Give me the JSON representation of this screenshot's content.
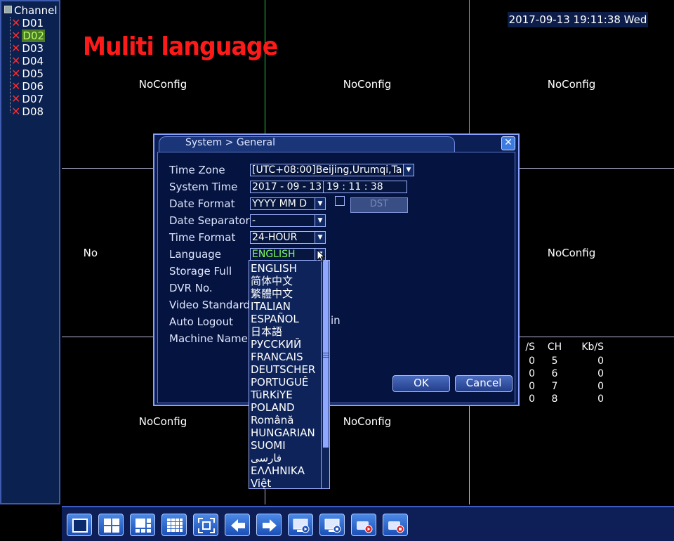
{
  "sidebar": {
    "header": "Channel",
    "items": [
      "D01",
      "D02",
      "D03",
      "D04",
      "D05",
      "D06",
      "D07",
      "D08"
    ],
    "selected_index": 1
  },
  "overlay_title": "Muliti language",
  "datetime": "2017-09-13 19:11:38 Wed",
  "cells": {
    "no_config_label": "NoConfig",
    "partial_label": "No"
  },
  "stats": {
    "headers": [
      "/S",
      "CH",
      "Kb/S"
    ],
    "rows": [
      [
        "0",
        "5",
        "0"
      ],
      [
        "0",
        "6",
        "0"
      ],
      [
        "0",
        "7",
        "0"
      ],
      [
        "0",
        "8",
        "0"
      ]
    ]
  },
  "dialog": {
    "title": "System > General",
    "close_label": "✕",
    "fields": {
      "time_zone": {
        "label": "Time Zone",
        "value": "[UTC+08:00]Beijing,Urumqi,Ta"
      },
      "system_time": {
        "label": "System Time",
        "date": "2017 - 09 - 13",
        "time": "19 : 11 : 38"
      },
      "date_format": {
        "label": "Date Format",
        "value": "YYYY MM D"
      },
      "date_separator": {
        "label": "Date Separator",
        "value": "-"
      },
      "time_format": {
        "label": "Time Format",
        "value": "24-HOUR"
      },
      "language": {
        "label": "Language",
        "value": "ENGLISH"
      },
      "storage_full": {
        "label": "Storage Full"
      },
      "dvr_no": {
        "label": "DVR No."
      },
      "video_standard": {
        "label": "Video Standard"
      },
      "auto_logout": {
        "label": "Auto Logout",
        "unit_suffix": "in"
      },
      "machine_name": {
        "label": "Machine Name"
      }
    },
    "dst_label": "DST",
    "ok_label": "OK",
    "cancel_label": "Cancel"
  },
  "language_options": [
    "ENGLISH",
    "简体中文",
    "繁體中文",
    "ITALIAN",
    "ESPAÑOL",
    "日本語",
    "РУССКИЙ",
    "FRANCAIS",
    "DEUTSCHER",
    "PORTUGUÊ",
    "TüRKiYE",
    "POLAND",
    "Română",
    "HUNGARIAN",
    "SUOMI",
    "فارسی",
    "ΕΛΛΗΝΙΚΑ",
    "Việt"
  ],
  "toolbar": {
    "icons": [
      "single-view-icon",
      "quad-view-icon",
      "nine-view-icon",
      "sixteen-view-icon",
      "fullscreen-icon",
      "previous-icon",
      "next-icon",
      "playback-icon",
      "record-icon",
      "record-start-icon",
      "record-stop-icon"
    ]
  },
  "colors": {
    "overlay_red": "#ff1a1a",
    "close_x_red": "#ff2a2a",
    "selected_green": "#b6ff66",
    "language_value_green": "#7dff5a"
  }
}
